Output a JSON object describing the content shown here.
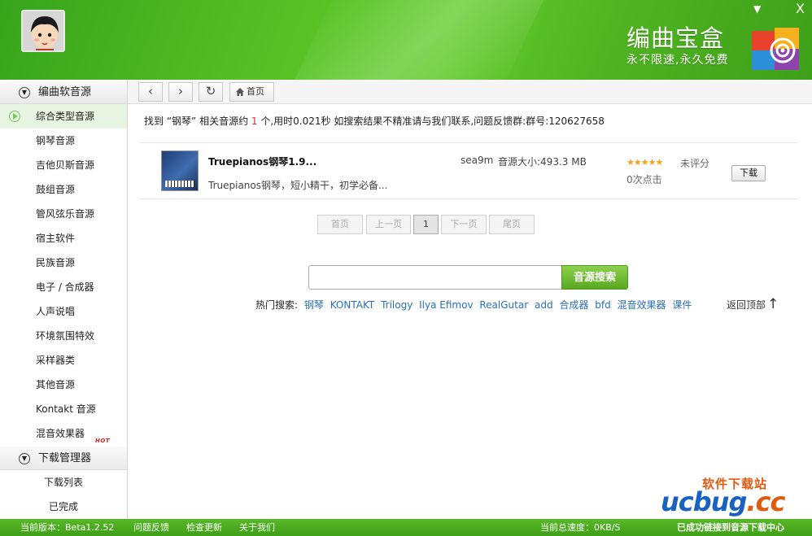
{
  "window": {
    "brand_title": "编曲宝盒",
    "brand_slogan": "永不限速,永久免费",
    "minimize_glyph": "▼",
    "close_glyph": "X"
  },
  "sidebar": {
    "group1_label": "编曲软音源",
    "items": [
      {
        "label": "综合类型音源",
        "active": true
      },
      {
        "label": "钢琴音源"
      },
      {
        "label": "吉他贝斯音源"
      },
      {
        "label": "鼓组音源"
      },
      {
        "label": "管风弦乐音源"
      },
      {
        "label": "宿主软件"
      },
      {
        "label": "民族音源"
      },
      {
        "label": "电子 / 合成器"
      },
      {
        "label": "人声说唱"
      },
      {
        "label": "环境氛围特效"
      },
      {
        "label": "采样器类"
      },
      {
        "label": "其他音源"
      },
      {
        "label": "Kontakt 音源"
      },
      {
        "label": "混音效果器",
        "badge": "HOT"
      }
    ],
    "group2_label": "下载管理器",
    "sub_items": [
      "下载列表",
      "已完成"
    ]
  },
  "nav": {
    "back_glyph": "‹",
    "forward_glyph": "›",
    "refresh_glyph": "↻",
    "home_label": "首页"
  },
  "search_result": {
    "prefix": "找到 “钢琴” 相关音源约 ",
    "count": "1",
    "suffix": " 个,用时0.021秒   如搜索结果不精准请与我们联系,问题反馈群:群号:120627658"
  },
  "results": [
    {
      "name": "Truepianos钢琴1.9...",
      "desc": "Truepianos钢琴，短小精干，初学必备...",
      "user": "sea9m",
      "size": "音源大小:493.3 MB",
      "stars": "★★★★★",
      "rating": "未评分",
      "clicks": "0次点击",
      "download_label": "下载"
    }
  ],
  "pager": {
    "first": "首页",
    "prev": "上一页",
    "current": "1",
    "next": "下一页",
    "last": "尾页"
  },
  "search": {
    "value": "",
    "button_label": "音源搜索"
  },
  "hot_search": {
    "label": "热门搜索:",
    "terms": [
      "钢琴",
      "KONTAKT",
      "Trilogy",
      "Ilya Efimov",
      "RealGutar",
      "add",
      "合成器",
      "bfd",
      "混音效果器",
      "课件"
    ]
  },
  "back_to_top": {
    "label": "返回顶部",
    "arrow": "↑"
  },
  "statusbar": {
    "version": "当前版本：Beta1.2.52",
    "feedback": "问题反馈",
    "check_update": "检查更新",
    "about": "关于我们",
    "speed": "当前总速度：0KB/S",
    "connection": "已成功链接到音源下载中心"
  },
  "watermark": {
    "top": "软件下载站",
    "big_left": "ucbug",
    "big_right": ".cc"
  },
  "colors": {
    "header_green": "#4fb321",
    "status_green": "#3f9e18",
    "link_blue": "#2a6fbb",
    "count_red": "#e03030",
    "star_orange": "#f3a21a"
  }
}
